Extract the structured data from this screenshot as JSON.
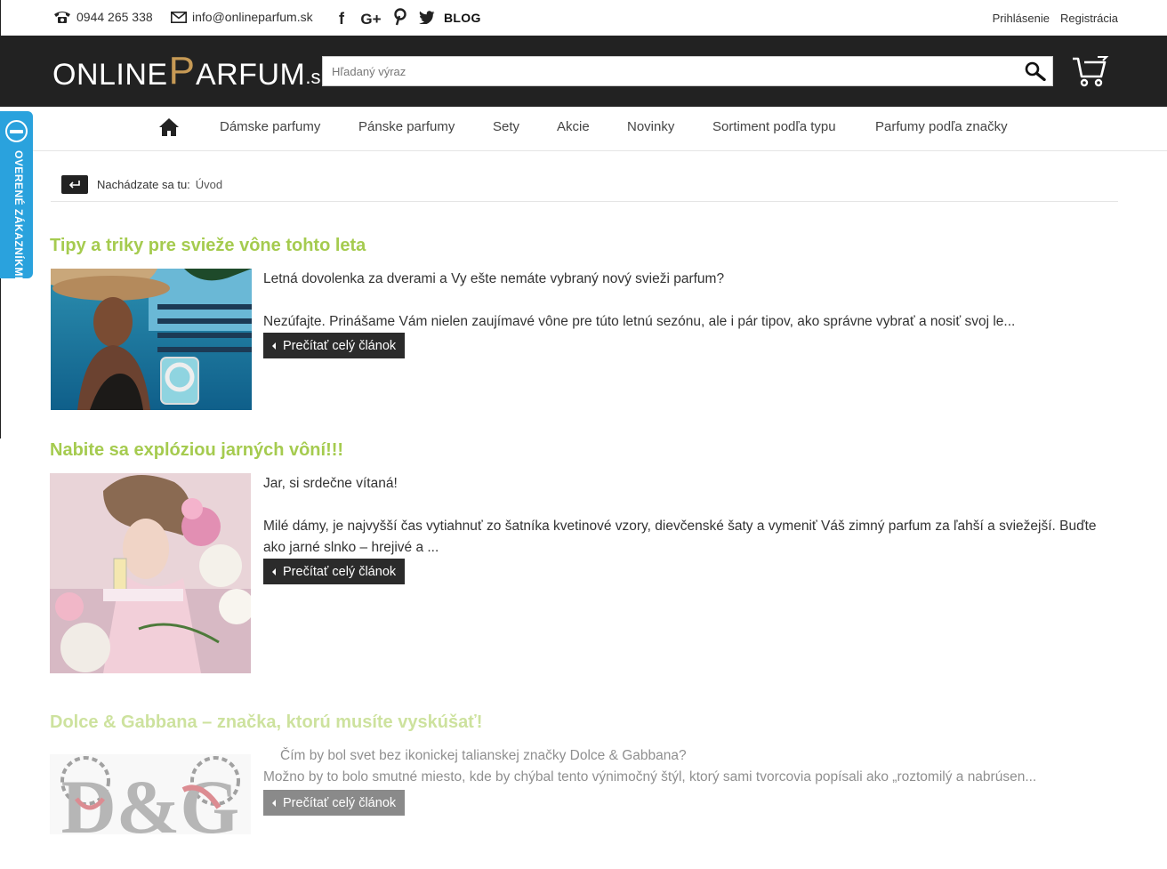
{
  "topbar": {
    "phone": "0944 265 338",
    "email": "info@onlineparfum.sk",
    "social_icons": [
      "facebook-icon",
      "google-plus-icon",
      "pinterest-icon",
      "twitter-icon"
    ],
    "blog_label": "BLOG",
    "login_label": "Prihlásenie",
    "register_label": "Registrácia"
  },
  "header": {
    "logo_part1": "ONLINE",
    "logo_p": "P",
    "logo_part2": "ARFUM",
    "logo_tld": ".sk",
    "search_placeholder": "Hľadaný výraz"
  },
  "nav": {
    "items": [
      {
        "label": "Dámske parfumy"
      },
      {
        "label": "Pánske parfumy"
      },
      {
        "label": "Sety"
      },
      {
        "label": "Akcie"
      },
      {
        "label": "Novinky"
      },
      {
        "label": "Sortiment podľa typu"
      },
      {
        "label": "Parfumy podľa značky"
      }
    ]
  },
  "sidetab": {
    "label": "OVERENÉ ZÁKAZNÍKMI"
  },
  "breadcrumb": {
    "prefix": "Nachádzate sa tu:",
    "home": "Úvod"
  },
  "articles": [
    {
      "title": "Tipy a triky pre svieže vône tohto leta",
      "intro": "Letná dovolenka za dverami a Vy ešte nemáte vybraný nový svieži parfum?",
      "text": "Nezúfajte. Prinášame Vám nielen zaujímavé vône pre túto letnú sezónu, ale i pár tipov, ako správne vybrať a nosiť svoj le...",
      "read_more": "Prečítať celý článok"
    },
    {
      "title": "Nabite sa explóziou jarných vôní!!!",
      "intro": "Jar, si srdečne vítaná!",
      "text": "Milé dámy, je najvyšší čas vytiahnuť zo šatníka kvetinové vzory, dievčenské šaty a vymeniť Váš zimný parfum za ľahší a sviežejší. Buďte ako jarné slnko – hrejivé a ...",
      "read_more": "Prečítať celý článok"
    },
    {
      "title": "Dolce & Gabbana – značka, ktorú musíte vyskúšať!",
      "intro": "Čím by bol svet bez ikonickej talianskej značky Dolce & Gabbana?",
      "text": "Možno by to bolo smutné miesto, kde by chýbal tento výnimočný štýl, ktorý sami tvorcovia popísali ako „roztomilý a nabrúsen...",
      "read_more": "Prečítať celý článok",
      "logo_text": "D&G"
    }
  ],
  "colors": {
    "header_bg": "#222222",
    "title_green": "#a5cb4f",
    "sidetab_blue": "#2aa2dd",
    "logo_gold": "#c79a55",
    "button_bg": "#2b2b2b"
  }
}
